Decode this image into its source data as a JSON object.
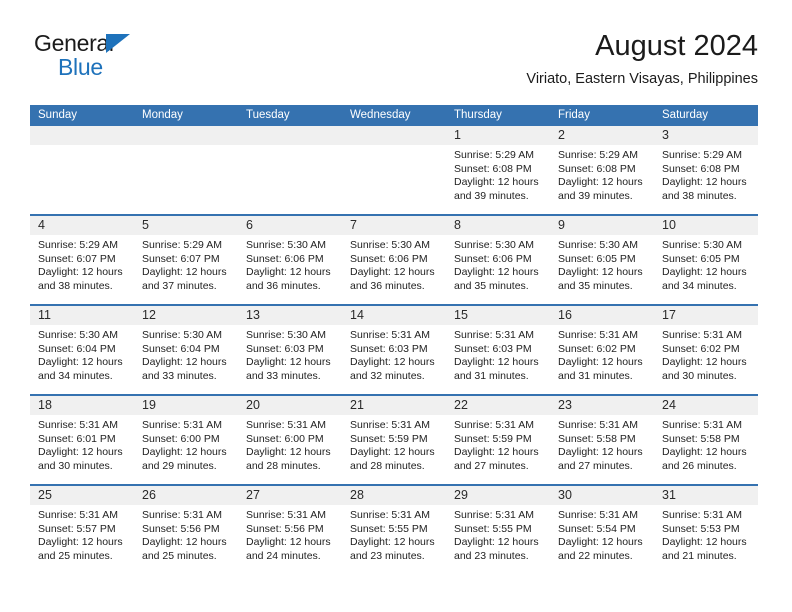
{
  "brand": {
    "name_part1": "General",
    "name_part2": "Blue",
    "triangle_color": "#1e72bb"
  },
  "header": {
    "title": "August 2024",
    "subtitle": "Viriato, Eastern Visayas, Philippines"
  },
  "theme": {
    "header_blue": "#3572b0",
    "daynum_band": "#f0f0f0",
    "text": "#1f1f1f"
  },
  "weekday_headers": [
    "Sunday",
    "Monday",
    "Tuesday",
    "Wednesday",
    "Thursday",
    "Friday",
    "Saturday"
  ],
  "weeks": [
    [
      {
        "day": "",
        "empty": true,
        "sunrise": "",
        "sunset": "",
        "daylight_line1": "",
        "daylight_line2": ""
      },
      {
        "day": "",
        "empty": true,
        "sunrise": "",
        "sunset": "",
        "daylight_line1": "",
        "daylight_line2": ""
      },
      {
        "day": "",
        "empty": true,
        "sunrise": "",
        "sunset": "",
        "daylight_line1": "",
        "daylight_line2": ""
      },
      {
        "day": "",
        "empty": true,
        "sunrise": "",
        "sunset": "",
        "daylight_line1": "",
        "daylight_line2": ""
      },
      {
        "day": "1",
        "empty": false,
        "sunrise": "Sunrise: 5:29 AM",
        "sunset": "Sunset: 6:08 PM",
        "daylight_line1": "Daylight: 12 hours",
        "daylight_line2": "and 39 minutes."
      },
      {
        "day": "2",
        "empty": false,
        "sunrise": "Sunrise: 5:29 AM",
        "sunset": "Sunset: 6:08 PM",
        "daylight_line1": "Daylight: 12 hours",
        "daylight_line2": "and 39 minutes."
      },
      {
        "day": "3",
        "empty": false,
        "sunrise": "Sunrise: 5:29 AM",
        "sunset": "Sunset: 6:08 PM",
        "daylight_line1": "Daylight: 12 hours",
        "daylight_line2": "and 38 minutes."
      }
    ],
    [
      {
        "day": "4",
        "empty": false,
        "sunrise": "Sunrise: 5:29 AM",
        "sunset": "Sunset: 6:07 PM",
        "daylight_line1": "Daylight: 12 hours",
        "daylight_line2": "and 38 minutes."
      },
      {
        "day": "5",
        "empty": false,
        "sunrise": "Sunrise: 5:29 AM",
        "sunset": "Sunset: 6:07 PM",
        "daylight_line1": "Daylight: 12 hours",
        "daylight_line2": "and 37 minutes."
      },
      {
        "day": "6",
        "empty": false,
        "sunrise": "Sunrise: 5:30 AM",
        "sunset": "Sunset: 6:06 PM",
        "daylight_line1": "Daylight: 12 hours",
        "daylight_line2": "and 36 minutes."
      },
      {
        "day": "7",
        "empty": false,
        "sunrise": "Sunrise: 5:30 AM",
        "sunset": "Sunset: 6:06 PM",
        "daylight_line1": "Daylight: 12 hours",
        "daylight_line2": "and 36 minutes."
      },
      {
        "day": "8",
        "empty": false,
        "sunrise": "Sunrise: 5:30 AM",
        "sunset": "Sunset: 6:06 PM",
        "daylight_line1": "Daylight: 12 hours",
        "daylight_line2": "and 35 minutes."
      },
      {
        "day": "9",
        "empty": false,
        "sunrise": "Sunrise: 5:30 AM",
        "sunset": "Sunset: 6:05 PM",
        "daylight_line1": "Daylight: 12 hours",
        "daylight_line2": "and 35 minutes."
      },
      {
        "day": "10",
        "empty": false,
        "sunrise": "Sunrise: 5:30 AM",
        "sunset": "Sunset: 6:05 PM",
        "daylight_line1": "Daylight: 12 hours",
        "daylight_line2": "and 34 minutes."
      }
    ],
    [
      {
        "day": "11",
        "empty": false,
        "sunrise": "Sunrise: 5:30 AM",
        "sunset": "Sunset: 6:04 PM",
        "daylight_line1": "Daylight: 12 hours",
        "daylight_line2": "and 34 minutes."
      },
      {
        "day": "12",
        "empty": false,
        "sunrise": "Sunrise: 5:30 AM",
        "sunset": "Sunset: 6:04 PM",
        "daylight_line1": "Daylight: 12 hours",
        "daylight_line2": "and 33 minutes."
      },
      {
        "day": "13",
        "empty": false,
        "sunrise": "Sunrise: 5:30 AM",
        "sunset": "Sunset: 6:03 PM",
        "daylight_line1": "Daylight: 12 hours",
        "daylight_line2": "and 33 minutes."
      },
      {
        "day": "14",
        "empty": false,
        "sunrise": "Sunrise: 5:31 AM",
        "sunset": "Sunset: 6:03 PM",
        "daylight_line1": "Daylight: 12 hours",
        "daylight_line2": "and 32 minutes."
      },
      {
        "day": "15",
        "empty": false,
        "sunrise": "Sunrise: 5:31 AM",
        "sunset": "Sunset: 6:03 PM",
        "daylight_line1": "Daylight: 12 hours",
        "daylight_line2": "and 31 minutes."
      },
      {
        "day": "16",
        "empty": false,
        "sunrise": "Sunrise: 5:31 AM",
        "sunset": "Sunset: 6:02 PM",
        "daylight_line1": "Daylight: 12 hours",
        "daylight_line2": "and 31 minutes."
      },
      {
        "day": "17",
        "empty": false,
        "sunrise": "Sunrise: 5:31 AM",
        "sunset": "Sunset: 6:02 PM",
        "daylight_line1": "Daylight: 12 hours",
        "daylight_line2": "and 30 minutes."
      }
    ],
    [
      {
        "day": "18",
        "empty": false,
        "sunrise": "Sunrise: 5:31 AM",
        "sunset": "Sunset: 6:01 PM",
        "daylight_line1": "Daylight: 12 hours",
        "daylight_line2": "and 30 minutes."
      },
      {
        "day": "19",
        "empty": false,
        "sunrise": "Sunrise: 5:31 AM",
        "sunset": "Sunset: 6:00 PM",
        "daylight_line1": "Daylight: 12 hours",
        "daylight_line2": "and 29 minutes."
      },
      {
        "day": "20",
        "empty": false,
        "sunrise": "Sunrise: 5:31 AM",
        "sunset": "Sunset: 6:00 PM",
        "daylight_line1": "Daylight: 12 hours",
        "daylight_line2": "and 28 minutes."
      },
      {
        "day": "21",
        "empty": false,
        "sunrise": "Sunrise: 5:31 AM",
        "sunset": "Sunset: 5:59 PM",
        "daylight_line1": "Daylight: 12 hours",
        "daylight_line2": "and 28 minutes."
      },
      {
        "day": "22",
        "empty": false,
        "sunrise": "Sunrise: 5:31 AM",
        "sunset": "Sunset: 5:59 PM",
        "daylight_line1": "Daylight: 12 hours",
        "daylight_line2": "and 27 minutes."
      },
      {
        "day": "23",
        "empty": false,
        "sunrise": "Sunrise: 5:31 AM",
        "sunset": "Sunset: 5:58 PM",
        "daylight_line1": "Daylight: 12 hours",
        "daylight_line2": "and 27 minutes."
      },
      {
        "day": "24",
        "empty": false,
        "sunrise": "Sunrise: 5:31 AM",
        "sunset": "Sunset: 5:58 PM",
        "daylight_line1": "Daylight: 12 hours",
        "daylight_line2": "and 26 minutes."
      }
    ],
    [
      {
        "day": "25",
        "empty": false,
        "sunrise": "Sunrise: 5:31 AM",
        "sunset": "Sunset: 5:57 PM",
        "daylight_line1": "Daylight: 12 hours",
        "daylight_line2": "and 25 minutes."
      },
      {
        "day": "26",
        "empty": false,
        "sunrise": "Sunrise: 5:31 AM",
        "sunset": "Sunset: 5:56 PM",
        "daylight_line1": "Daylight: 12 hours",
        "daylight_line2": "and 25 minutes."
      },
      {
        "day": "27",
        "empty": false,
        "sunrise": "Sunrise: 5:31 AM",
        "sunset": "Sunset: 5:56 PM",
        "daylight_line1": "Daylight: 12 hours",
        "daylight_line2": "and 24 minutes."
      },
      {
        "day": "28",
        "empty": false,
        "sunrise": "Sunrise: 5:31 AM",
        "sunset": "Sunset: 5:55 PM",
        "daylight_line1": "Daylight: 12 hours",
        "daylight_line2": "and 23 minutes."
      },
      {
        "day": "29",
        "empty": false,
        "sunrise": "Sunrise: 5:31 AM",
        "sunset": "Sunset: 5:55 PM",
        "daylight_line1": "Daylight: 12 hours",
        "daylight_line2": "and 23 minutes."
      },
      {
        "day": "30",
        "empty": false,
        "sunrise": "Sunrise: 5:31 AM",
        "sunset": "Sunset: 5:54 PM",
        "daylight_line1": "Daylight: 12 hours",
        "daylight_line2": "and 22 minutes."
      },
      {
        "day": "31",
        "empty": false,
        "sunrise": "Sunrise: 5:31 AM",
        "sunset": "Sunset: 5:53 PM",
        "daylight_line1": "Daylight: 12 hours",
        "daylight_line2": "and 21 minutes."
      }
    ]
  ]
}
